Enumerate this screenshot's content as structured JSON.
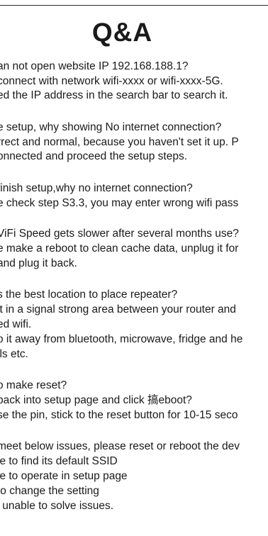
{
  "title": "Q&A",
  "lines": [
    "an not open website IP 192.168.188.1?",
    " connect with network wifi-xxxx or wifi-xxxx-5G.",
    "ed the IP address in the search bar to search it.",
    "",
    "e setup, why showing No internet connection?",
    "rrect and normal, because you haven't set it up. P",
    "onnected and proceed the setup steps.",
    "",
    "finish setup,why no internet connection?",
    "e check step S3.3, you may enter wrong wifi pass",
    "",
    "ViFi Speed gets slower after several months use?",
    "e make a reboot to clean cache data, unplug it for",
    "and plug it back.",
    "",
    "s the best location to place repeater?",
    " it in a signal strong area between your router and",
    "ed wifi.",
    "o it away from bluetooth, microwave, fridge and he",
    "lls etc.",
    "",
    "o make reset?",
    " back into setup page and click 搞eboot?",
    "se the pin, stick to the reset button for 10-15 seco",
    "",
    "meet below issues, please reset or reboot the dev",
    "le to find its default SSID",
    "le to operate in setup page",
    " to change the setting",
    "' unable to solve issues."
  ]
}
